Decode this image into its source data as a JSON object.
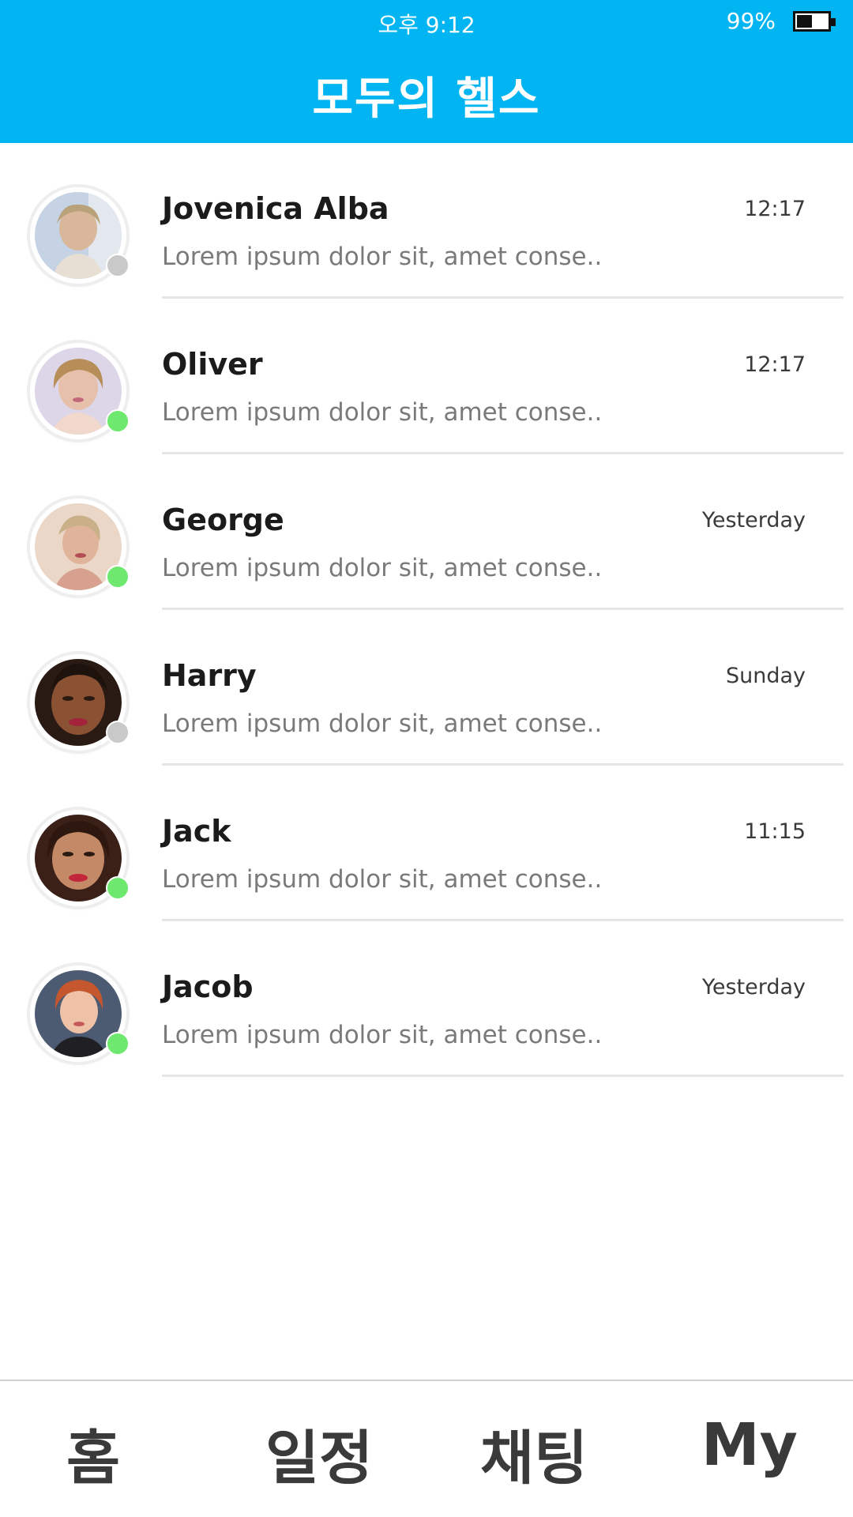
{
  "status_bar": {
    "time": "오후 9:12",
    "battery": "99%"
  },
  "header": {
    "title": "모두의 헬스"
  },
  "chats": [
    {
      "name": "Jovenica Alba",
      "preview": "Lorem ipsum dolor sit, amet conse..",
      "time": "12:17",
      "online": false
    },
    {
      "name": "Oliver",
      "preview": "Lorem ipsum dolor sit, amet conse..",
      "time": "12:17",
      "online": true
    },
    {
      "name": "George",
      "preview": "Lorem ipsum dolor sit, amet conse..",
      "time": "Yesterday",
      "online": true
    },
    {
      "name": "Harry",
      "preview": "Lorem ipsum dolor sit, amet conse..",
      "time": "Sunday",
      "online": false
    },
    {
      "name": "Jack",
      "preview": "Lorem ipsum dolor sit, amet conse..",
      "time": "11:15",
      "online": true
    },
    {
      "name": "Jacob",
      "preview": "Lorem ipsum dolor sit, amet conse..",
      "time": "Yesterday",
      "online": true
    }
  ],
  "nav": {
    "home": "홈",
    "schedule": "일정",
    "chat": "채팅",
    "my": "My"
  },
  "colors": {
    "header_bg": "#00b5f1",
    "online": "#6fe86f",
    "offline": "#c9c9c9"
  }
}
